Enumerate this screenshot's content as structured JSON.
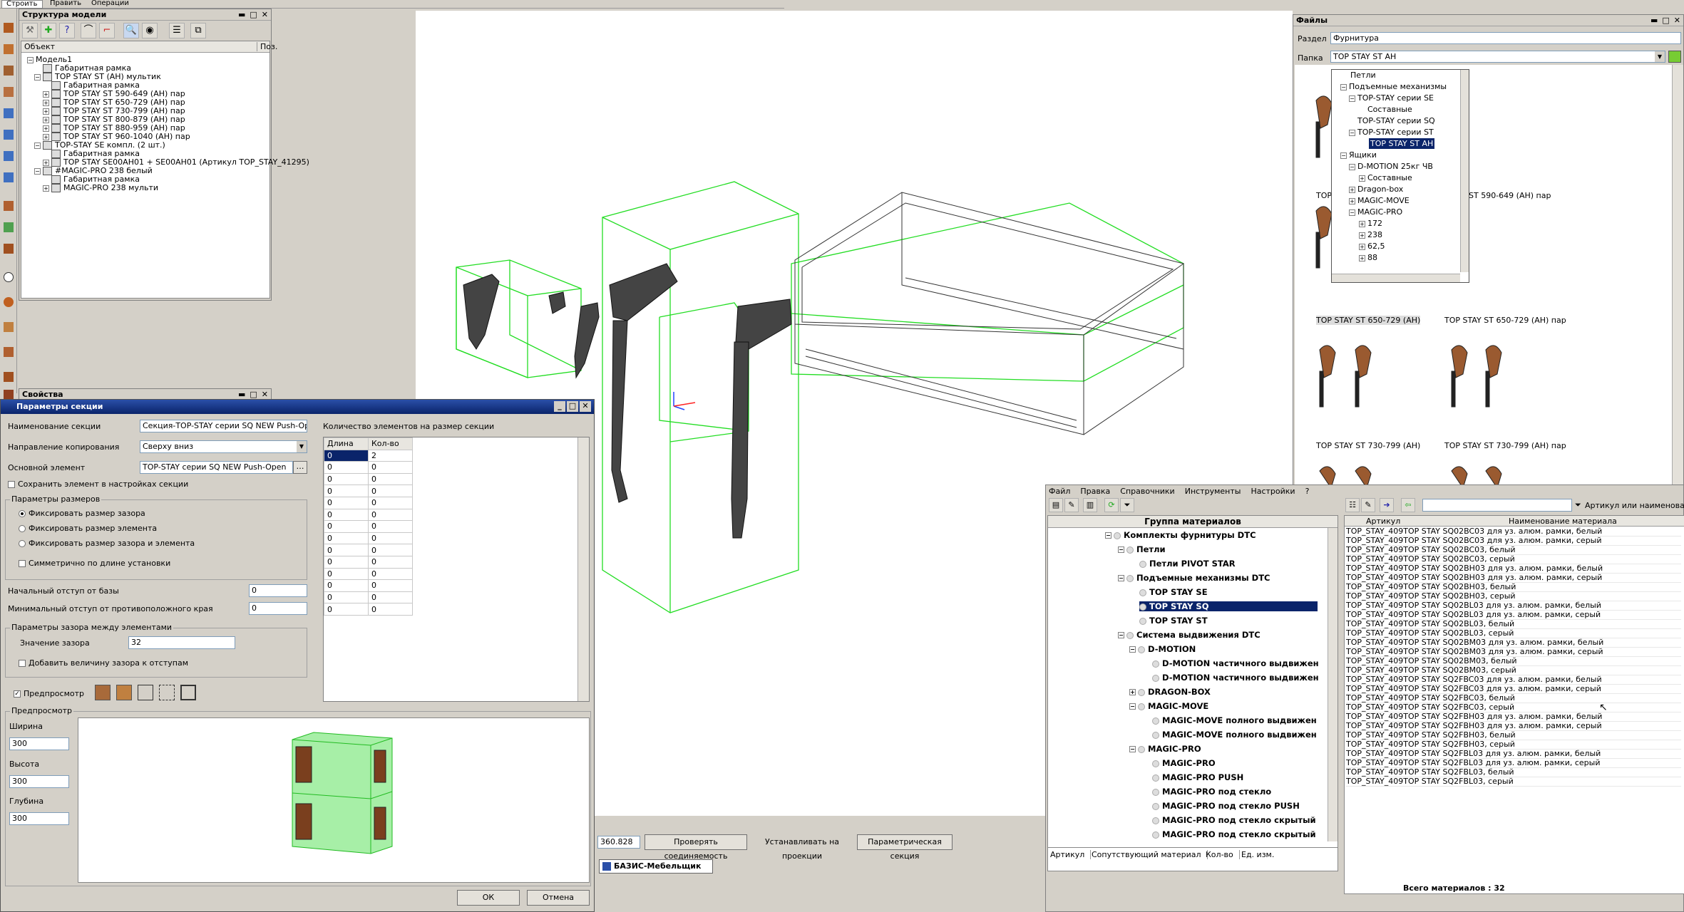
{
  "top_tabs": [
    "Строить",
    "Править",
    "Операции"
  ],
  "model_structure": {
    "title": "Структура модели",
    "col_object": "Объект",
    "col_pos": "Поз.",
    "items": [
      "Модель1",
      "Габаритная рамка",
      "TOP STAY ST (AH) мультик",
      "Габаритная рамка",
      "TOP STAY ST 590-649 (AH) пар",
      "TOP STAY ST 650-729 (AH) пар",
      "TOP STAY ST 730-799 (AH) пар",
      "TOP STAY ST 800-879 (AH) пар",
      "TOP STAY ST 880-959 (AH) пар",
      "TOP STAY ST 960-1040 (AH) пар",
      "TOP-STAY SE компл. (2 шт.)",
      "Габаритная рамка",
      "TOP STAY SE00AH01 + SE00AH01 (Артикул TOP_STAY_41295)",
      "#MAGIC-PRO 238 белый",
      "Габаритная рамка",
      "MAGIC-PRO 238 мульти"
    ]
  },
  "properties_title": "Свойства",
  "section_dialog": {
    "title": "Параметры секции",
    "name_label": "Наименование секции",
    "name_value": "Секция-TOP-STAY серии SQ NEW Push-Open",
    "dir_label": "Направление копирования",
    "dir_value": "Сверху вниз",
    "main_label": "Основной элемент",
    "main_value": "TOP-STAY серии SQ NEW Push-Open",
    "save_label": "Сохранить элемент в настройках секции",
    "size_group": "Параметры размеров",
    "radio1": "Фиксировать размер зазора",
    "radio2": "Фиксировать размер элемента",
    "radio3": "Фиксировать размер зазора и элемента",
    "sym_label": "Симметрично по длине установки",
    "start_label": "Начальный отступ от базы",
    "start_value": "0",
    "min_label": "Минимальный отступ от противоположного края",
    "min_value": "0",
    "gap_group": "Параметры зазора между элементами",
    "gap_label": "Значение зазора",
    "gap_value": "32",
    "add_gap_label": "Добавить величину зазора к отступам",
    "count_title": "Количество элементов на размер секции",
    "col_len": "Длина",
    "col_qty": "Кол-во",
    "rows": [
      [
        "0",
        "2"
      ],
      [
        "0",
        "0"
      ],
      [
        "0",
        "0"
      ],
      [
        "0",
        "0"
      ],
      [
        "0",
        "0"
      ],
      [
        "0",
        "0"
      ],
      [
        "0",
        "0"
      ],
      [
        "0",
        "0"
      ],
      [
        "0",
        "0"
      ],
      [
        "0",
        "0"
      ],
      [
        "0",
        "0"
      ],
      [
        "0",
        "0"
      ],
      [
        "0",
        "0"
      ],
      [
        "0",
        "0"
      ]
    ],
    "preview_chk": "Предпросмотр",
    "preview_group": "Предпросмотр",
    "width_label": "Ширина",
    "width_value": "300",
    "height_label": "Высота",
    "height_value": "300",
    "depth_label": "Глубина",
    "depth_value": "300",
    "ok": "ОК",
    "cancel": "Отмена"
  },
  "status": {
    "coord": "360.828",
    "b1": "Проверять соединяемость",
    "b2": "Устанавливать на проекции",
    "b3": "Параметрическая секция",
    "taskbar": "БАЗИС-Мебельщик"
  },
  "files": {
    "title": "Файлы",
    "section_label": "Раздел",
    "section_value": "Фурнитура",
    "folder_label": "Папка",
    "folder_value": "TOP STAY ST AH",
    "tree": [
      "Петли",
      "Подъемные механизмы",
      "TOP-STAY серии SE",
      "Составные",
      "TOP-STAY серии SQ",
      "TOP-STAY серии ST",
      "TOP STAY ST AH",
      "Ящики",
      "D-MOTION 25кг ЧВ",
      "Составные",
      "Dragon-box",
      "MAGIC-MOVE",
      "MAGIC-PRO",
      "172",
      "238",
      "62,5",
      "88"
    ],
    "captions": [
      "TOP",
      "ST 590-649 (AH) пар",
      "TOP STAY ST 650-729 (AH)",
      "TOP STAY ST 650-729 (AH) пар",
      "TOP STAY ST 730-799 (AH)",
      "TOP STAY ST 730-799 (AH) пар"
    ]
  },
  "materials": {
    "menu": [
      "Файл",
      "Правка",
      "Справочники",
      "Инструменты",
      "Настройки",
      "?"
    ],
    "group_header": "Группа материалов",
    "search_placeholder": "Артикул или наименование",
    "groups": [
      "Комплекты фурнитуры DTC",
      "Петли",
      "Петли PIVOT STAR",
      "Подъемные механизмы DTC",
      "TOP STAY SE",
      "TOP STAY SQ",
      "TOP STAY ST",
      "Система выдвижения DTC",
      "D-MOTION",
      "D-MOTION частичного выдвижен",
      "D-MOTION частичного выдвижен",
      "DRAGON-BOX",
      "MAGIC-MOVE",
      "MAGIC-MOVE полного выдвижен",
      "MAGIC-MOVE полного выдвижен",
      "MAGIC-PRO",
      "MAGIC-PRO",
      "MAGIC-PRO PUSH",
      "MAGIC-PRO под стекло",
      "MAGIC-PRO под стекло PUSH",
      "MAGIC-PRO под стекло скрытый",
      "MAGIC-PRO под стекло скрытый"
    ],
    "tabs": [
      "Артикул",
      "Сопутствующий материал",
      "Кол-во",
      "Ед. изм."
    ],
    "col_art": "Артикул",
    "col_name": "Наименование материала",
    "rows": [
      [
        "TOP_STAY_409",
        "TOP STAY SQ02BC03 для уз. алюм. рамки, белый"
      ],
      [
        "TOP_STAY_409",
        "TOP STAY SQ02BC03 для уз. алюм. рамки, серый"
      ],
      [
        "TOP_STAY_409",
        "TOP STAY SQ02BC03, белый"
      ],
      [
        "TOP_STAY_409",
        "TOP STAY SQ02BC03, серый"
      ],
      [
        "TOP_STAY_409",
        "TOP STAY SQ02BH03 для уз. алюм. рамки, белый"
      ],
      [
        "TOP_STAY_409",
        "TOP STAY SQ02BH03 для уз. алюм. рамки, серый"
      ],
      [
        "TOP_STAY_409",
        "TOP STAY SQ02BH03, белый"
      ],
      [
        "TOP_STAY_409",
        "TOP STAY SQ02BH03, серый"
      ],
      [
        "TOP_STAY_409",
        "TOP STAY SQ02BL03 для уз. алюм. рамки, белый"
      ],
      [
        "TOP_STAY_409",
        "TOP STAY SQ02BL03 для уз. алюм. рамки, серый"
      ],
      [
        "TOP_STAY_409",
        "TOP STAY SQ02BL03, белый"
      ],
      [
        "TOP_STAY_409",
        "TOP STAY SQ02BL03, серый"
      ],
      [
        "TOP_STAY_409",
        "TOP STAY SQ02BM03 для уз. алюм. рамки, белый"
      ],
      [
        "TOP_STAY_409",
        "TOP STAY SQ02BM03 для уз. алюм. рамки, серый"
      ],
      [
        "TOP_STAY_409",
        "TOP STAY SQ02BM03, белый"
      ],
      [
        "TOP_STAY_409",
        "TOP STAY SQ02BM03, серый"
      ],
      [
        "TOP_STAY_409",
        "TOP STAY SQ2FBC03 для уз. алюм. рамки, белый"
      ],
      [
        "TOP_STAY_409",
        "TOP STAY SQ2FBC03 для уз. алюм. рамки, серый"
      ],
      [
        "TOP_STAY_409",
        "TOP STAY SQ2FBC03, белый"
      ],
      [
        "TOP_STAY_409",
        "TOP STAY SQ2FBC03, серый"
      ],
      [
        "TOP_STAY_409",
        "TOP STAY SQ2FBH03 для уз. алюм. рамки, белый"
      ],
      [
        "TOP_STAY_409",
        "TOP STAY SQ2FBH03 для уз. алюм. рамки, серый"
      ],
      [
        "TOP_STAY_409",
        "TOP STAY SQ2FBH03, белый"
      ],
      [
        "TOP_STAY_409",
        "TOP STAY SQ2FBH03, серый"
      ],
      [
        "TOP_STAY_409",
        "TOP STAY SQ2FBL03 для уз. алюм. рамки, белый"
      ],
      [
        "TOP_STAY_409",
        "TOP STAY SQ2FBL03 для уз. алюм. рамки, серый"
      ],
      [
        "TOP_STAY_409",
        "TOP STAY SQ2FBL03, белый"
      ],
      [
        "TOP_STAY_409",
        "TOP STAY SQ2FBL03, серый"
      ]
    ],
    "total": "Всего материалов : 32"
  }
}
